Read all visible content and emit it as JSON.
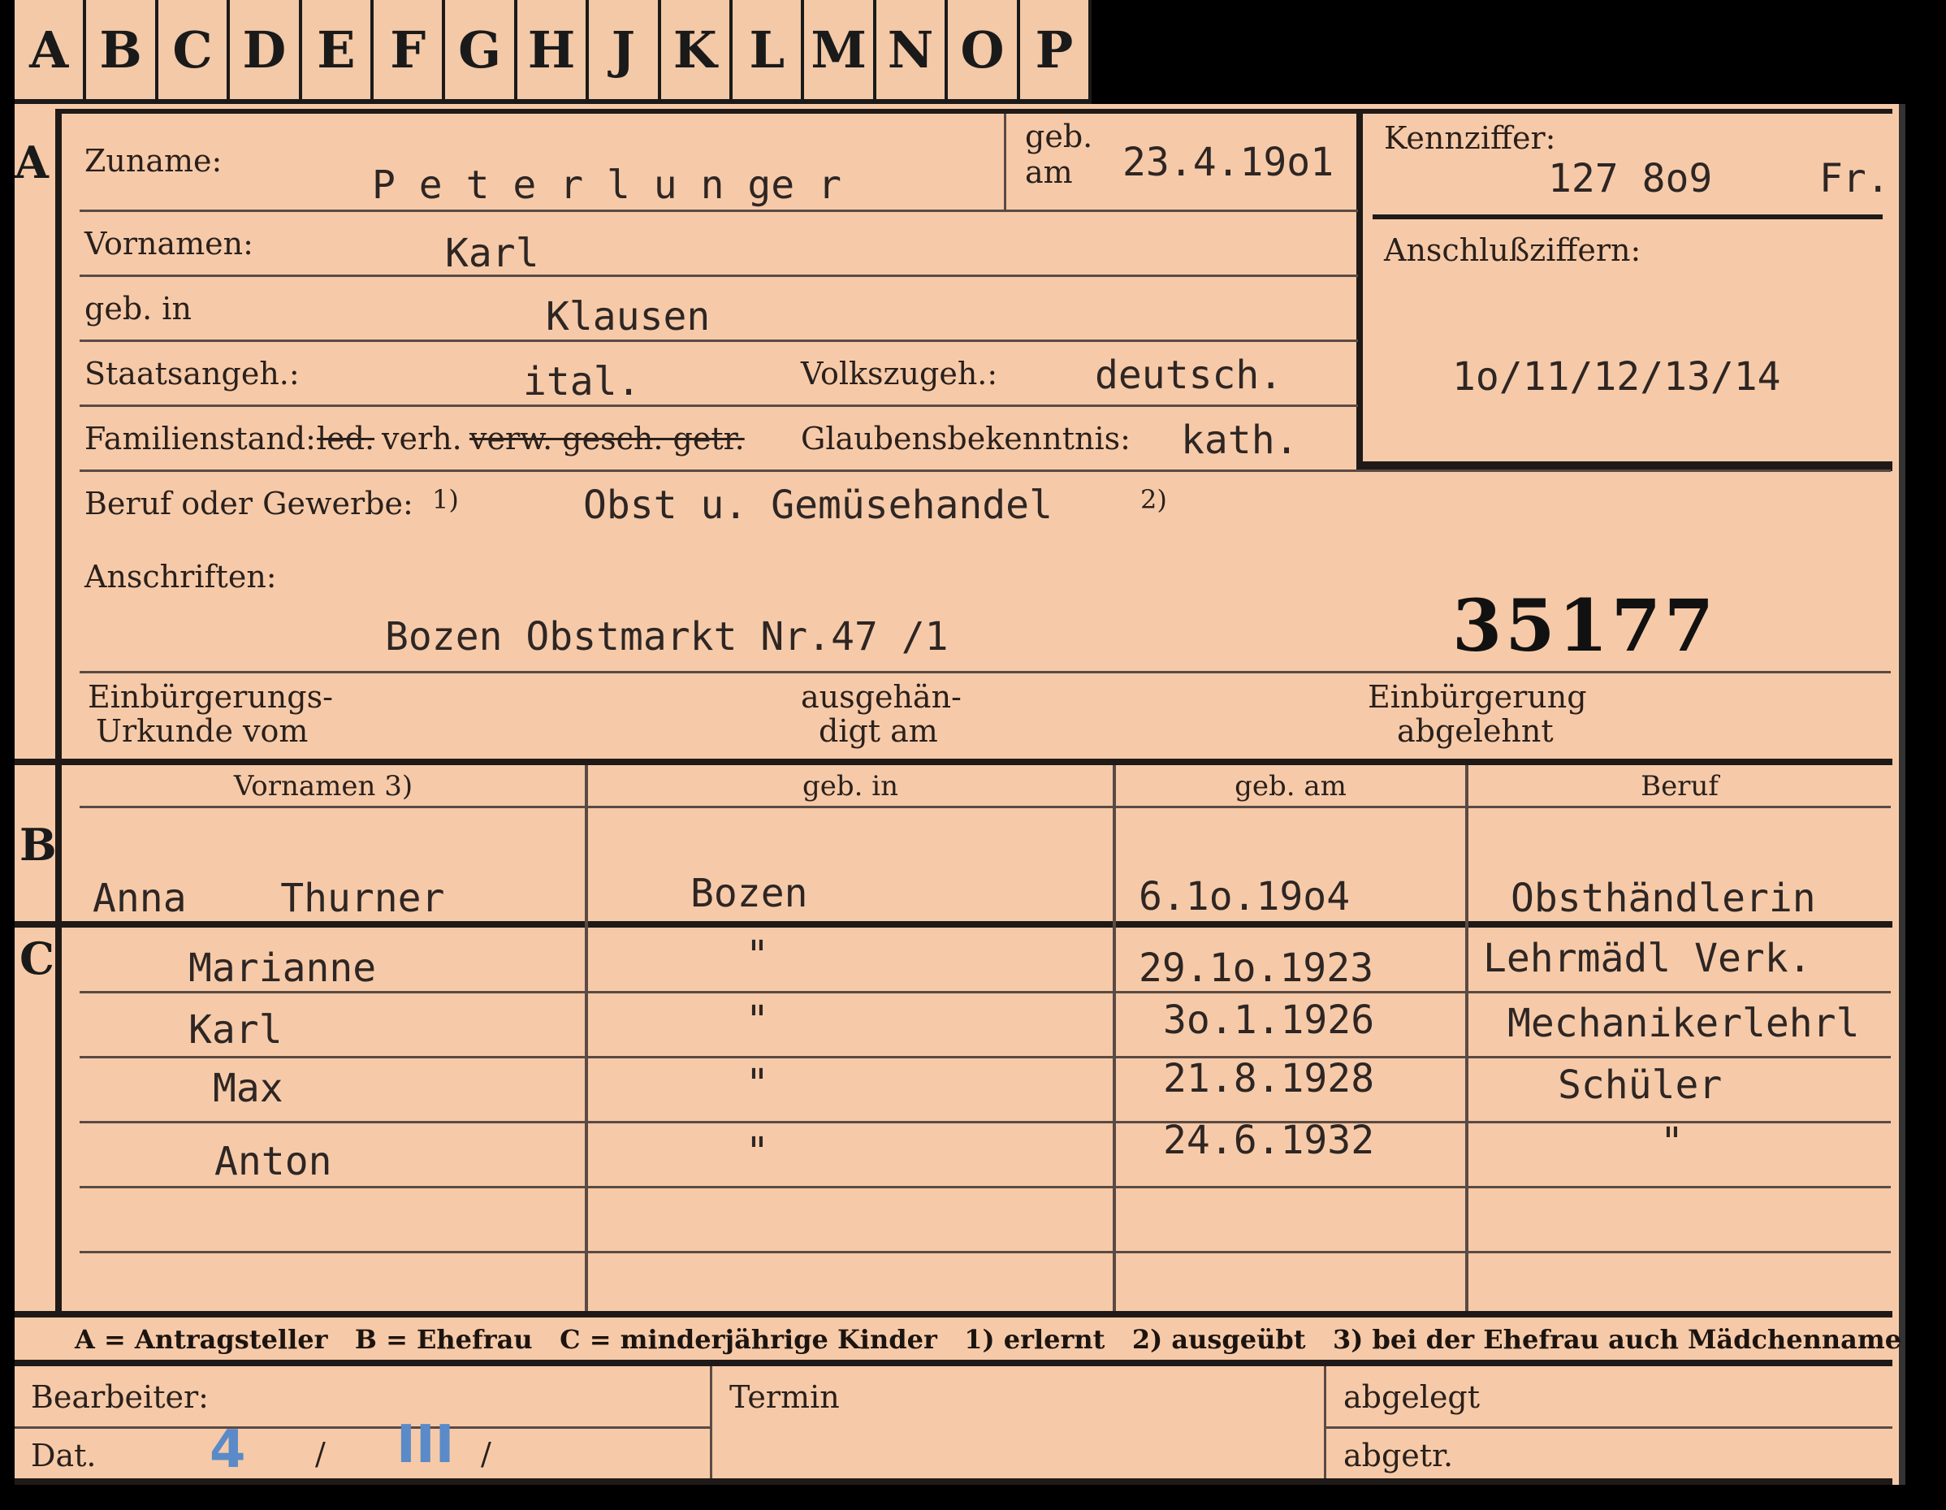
{
  "tabs": [
    "A",
    "B",
    "C",
    "D",
    "E",
    "F",
    "G",
    "H",
    "J",
    "K",
    "L",
    "M",
    "N",
    "O",
    "P"
  ],
  "sections": {
    "a": "A",
    "b": "B",
    "c": "C"
  },
  "header": {
    "surname_label": "Zuname:",
    "surname": "P e t e r l u n ge r",
    "born_label_1": "geb.",
    "born_label_2": "am",
    "born_date": "23.4.19o1",
    "id_label": "Kennziffer:",
    "id_number": "127 8o9",
    "id_suffix": "Fr.",
    "firstname_label": "Vornamen:",
    "firstname": "Karl",
    "birthplace_label": "geb. in",
    "birthplace": "Klausen",
    "related_label": "Anschlußziffern:",
    "related_numbers": "1o/11/12/13/14",
    "citizenship_label": "Staatsangeh.:",
    "citizenship": "ital.",
    "ethnicity_label": "Volkszugeh.:",
    "ethnicity": "deutsch.",
    "marital_label": "Familienstand:",
    "marital_options_left": "led.",
    "marital_selected": "verh.",
    "marital_options_right": "verw. gesch. getr.",
    "religion_label": "Glaubensbekenntnis:",
    "religion": "kath.",
    "occupation_label": "Beruf oder Gewerbe:",
    "occupation_note1": "1)",
    "occupation": "Obst u. Gemüsehandel",
    "occupation_note2": "2)",
    "address_label": "Anschriften:",
    "address": "Bozen Obstmarkt Nr.47 /1",
    "case_number": "35177",
    "naturalization_label_1": "Einbürgerungs-",
    "naturalization_label_2": "Urkunde vom",
    "handed_label_1": "ausgehän-",
    "handed_label_2": "digt am",
    "rejected_label_1": "Einbürgerung",
    "rejected_label_2": "abgelehnt"
  },
  "table": {
    "headers": [
      "Vornamen 3)",
      "geb. in",
      "geb. am",
      "Beruf"
    ],
    "spouse": {
      "name": "Anna    Thurner",
      "place": "Bozen",
      "date": "6.1o.19o4",
      "occupation": "Obsthändlerin"
    },
    "children": [
      {
        "name": "Marianne",
        "place": "\"",
        "date": "29.1o.1923",
        "occupation": "Lehrmädl Verk."
      },
      {
        "name": "Karl",
        "place": "\"",
        "date": "3o.1.1926",
        "occupation": "Mechanikerlehrl"
      },
      {
        "name": "Max",
        "place": "\"",
        "date": "21.8.1928",
        "occupation": "Schüler"
      },
      {
        "name": "Anton",
        "place": "\"",
        "date": "24.6.1932",
        "occupation": "\""
      }
    ]
  },
  "legend": "A = Antragsteller   B = Ehefrau   C = minderjährige Kinder   1) erlernt   2) ausgeübt   3) bei der Ehefrau auch Mädchenname",
  "footer": {
    "editor_label": "Bearbeiter:",
    "date_label": "Dat.",
    "date_value_1": "4",
    "slash_1": "/",
    "date_value_2": "III",
    "slash_2": "/",
    "deadline_label": "Termin",
    "filed_label": "abgelegt",
    "out_label": "abgetr."
  }
}
